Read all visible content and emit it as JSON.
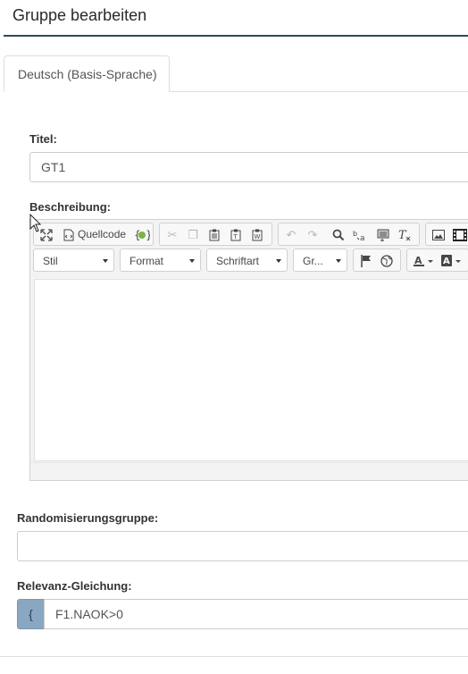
{
  "header": {
    "title": "Gruppe bearbeiten"
  },
  "tabs": [
    {
      "label": "Deutsch (Basis-Sprache)"
    }
  ],
  "fields": {
    "title_label": "Titel:",
    "title_value": "GT1",
    "description_label": "Beschreibung:",
    "random_group_label": "Randomisierungsgruppe:",
    "random_group_value": "",
    "relevance_label": "Relevanz-Gleichung:",
    "relevance_addon": "{",
    "relevance_value": "F1.NAOK>0"
  },
  "editor": {
    "source_label": "Quellcode",
    "style_combo": "Stil",
    "format_combo": "Format",
    "font_combo": "Schriftart",
    "size_combo": "Gr..."
  },
  "colors": {
    "header_rule": "#2c4a57",
    "addon_bg": "#8aa7c2"
  }
}
